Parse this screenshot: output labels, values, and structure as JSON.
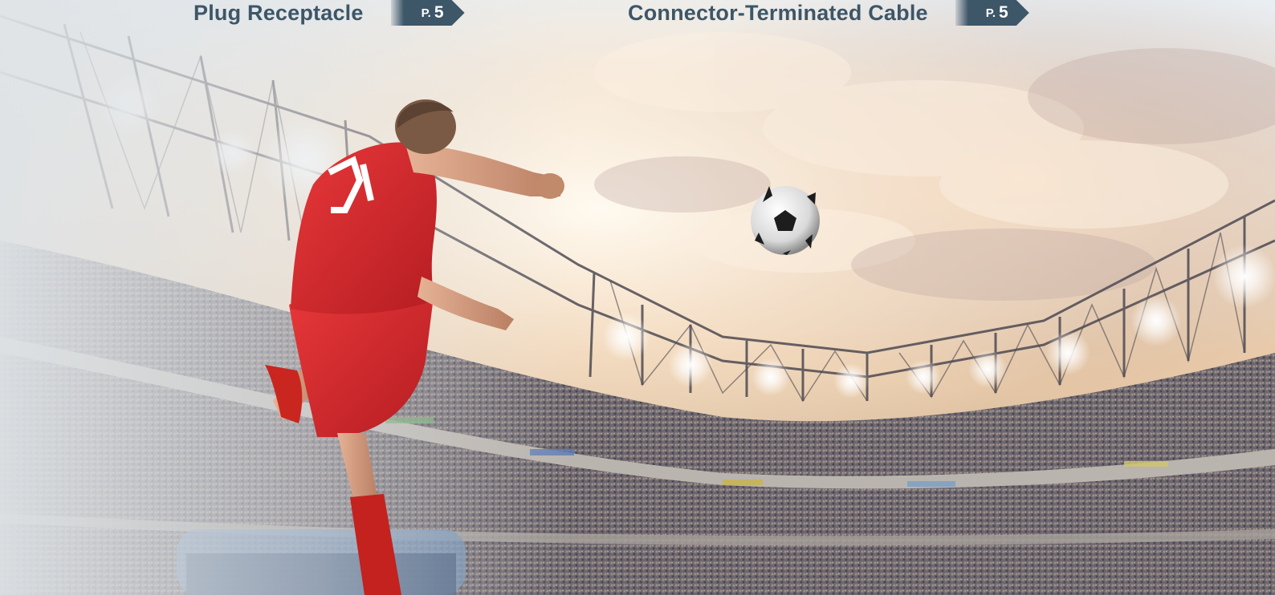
{
  "links": [
    {
      "label": "Plug Receptacle",
      "page_prefix": "P.",
      "page_number": "5"
    },
    {
      "label": "Connector-Terminated Cable",
      "page_prefix": "P.",
      "page_number": "5"
    }
  ],
  "photo": {
    "subject": "soccer-player-kicking-ball-in-stadium",
    "player_number": "21"
  },
  "colors": {
    "link_text": "#3d5668",
    "tag_background": "#3d5668",
    "tag_text": "#ffffff",
    "jersey": "#d8262a"
  }
}
